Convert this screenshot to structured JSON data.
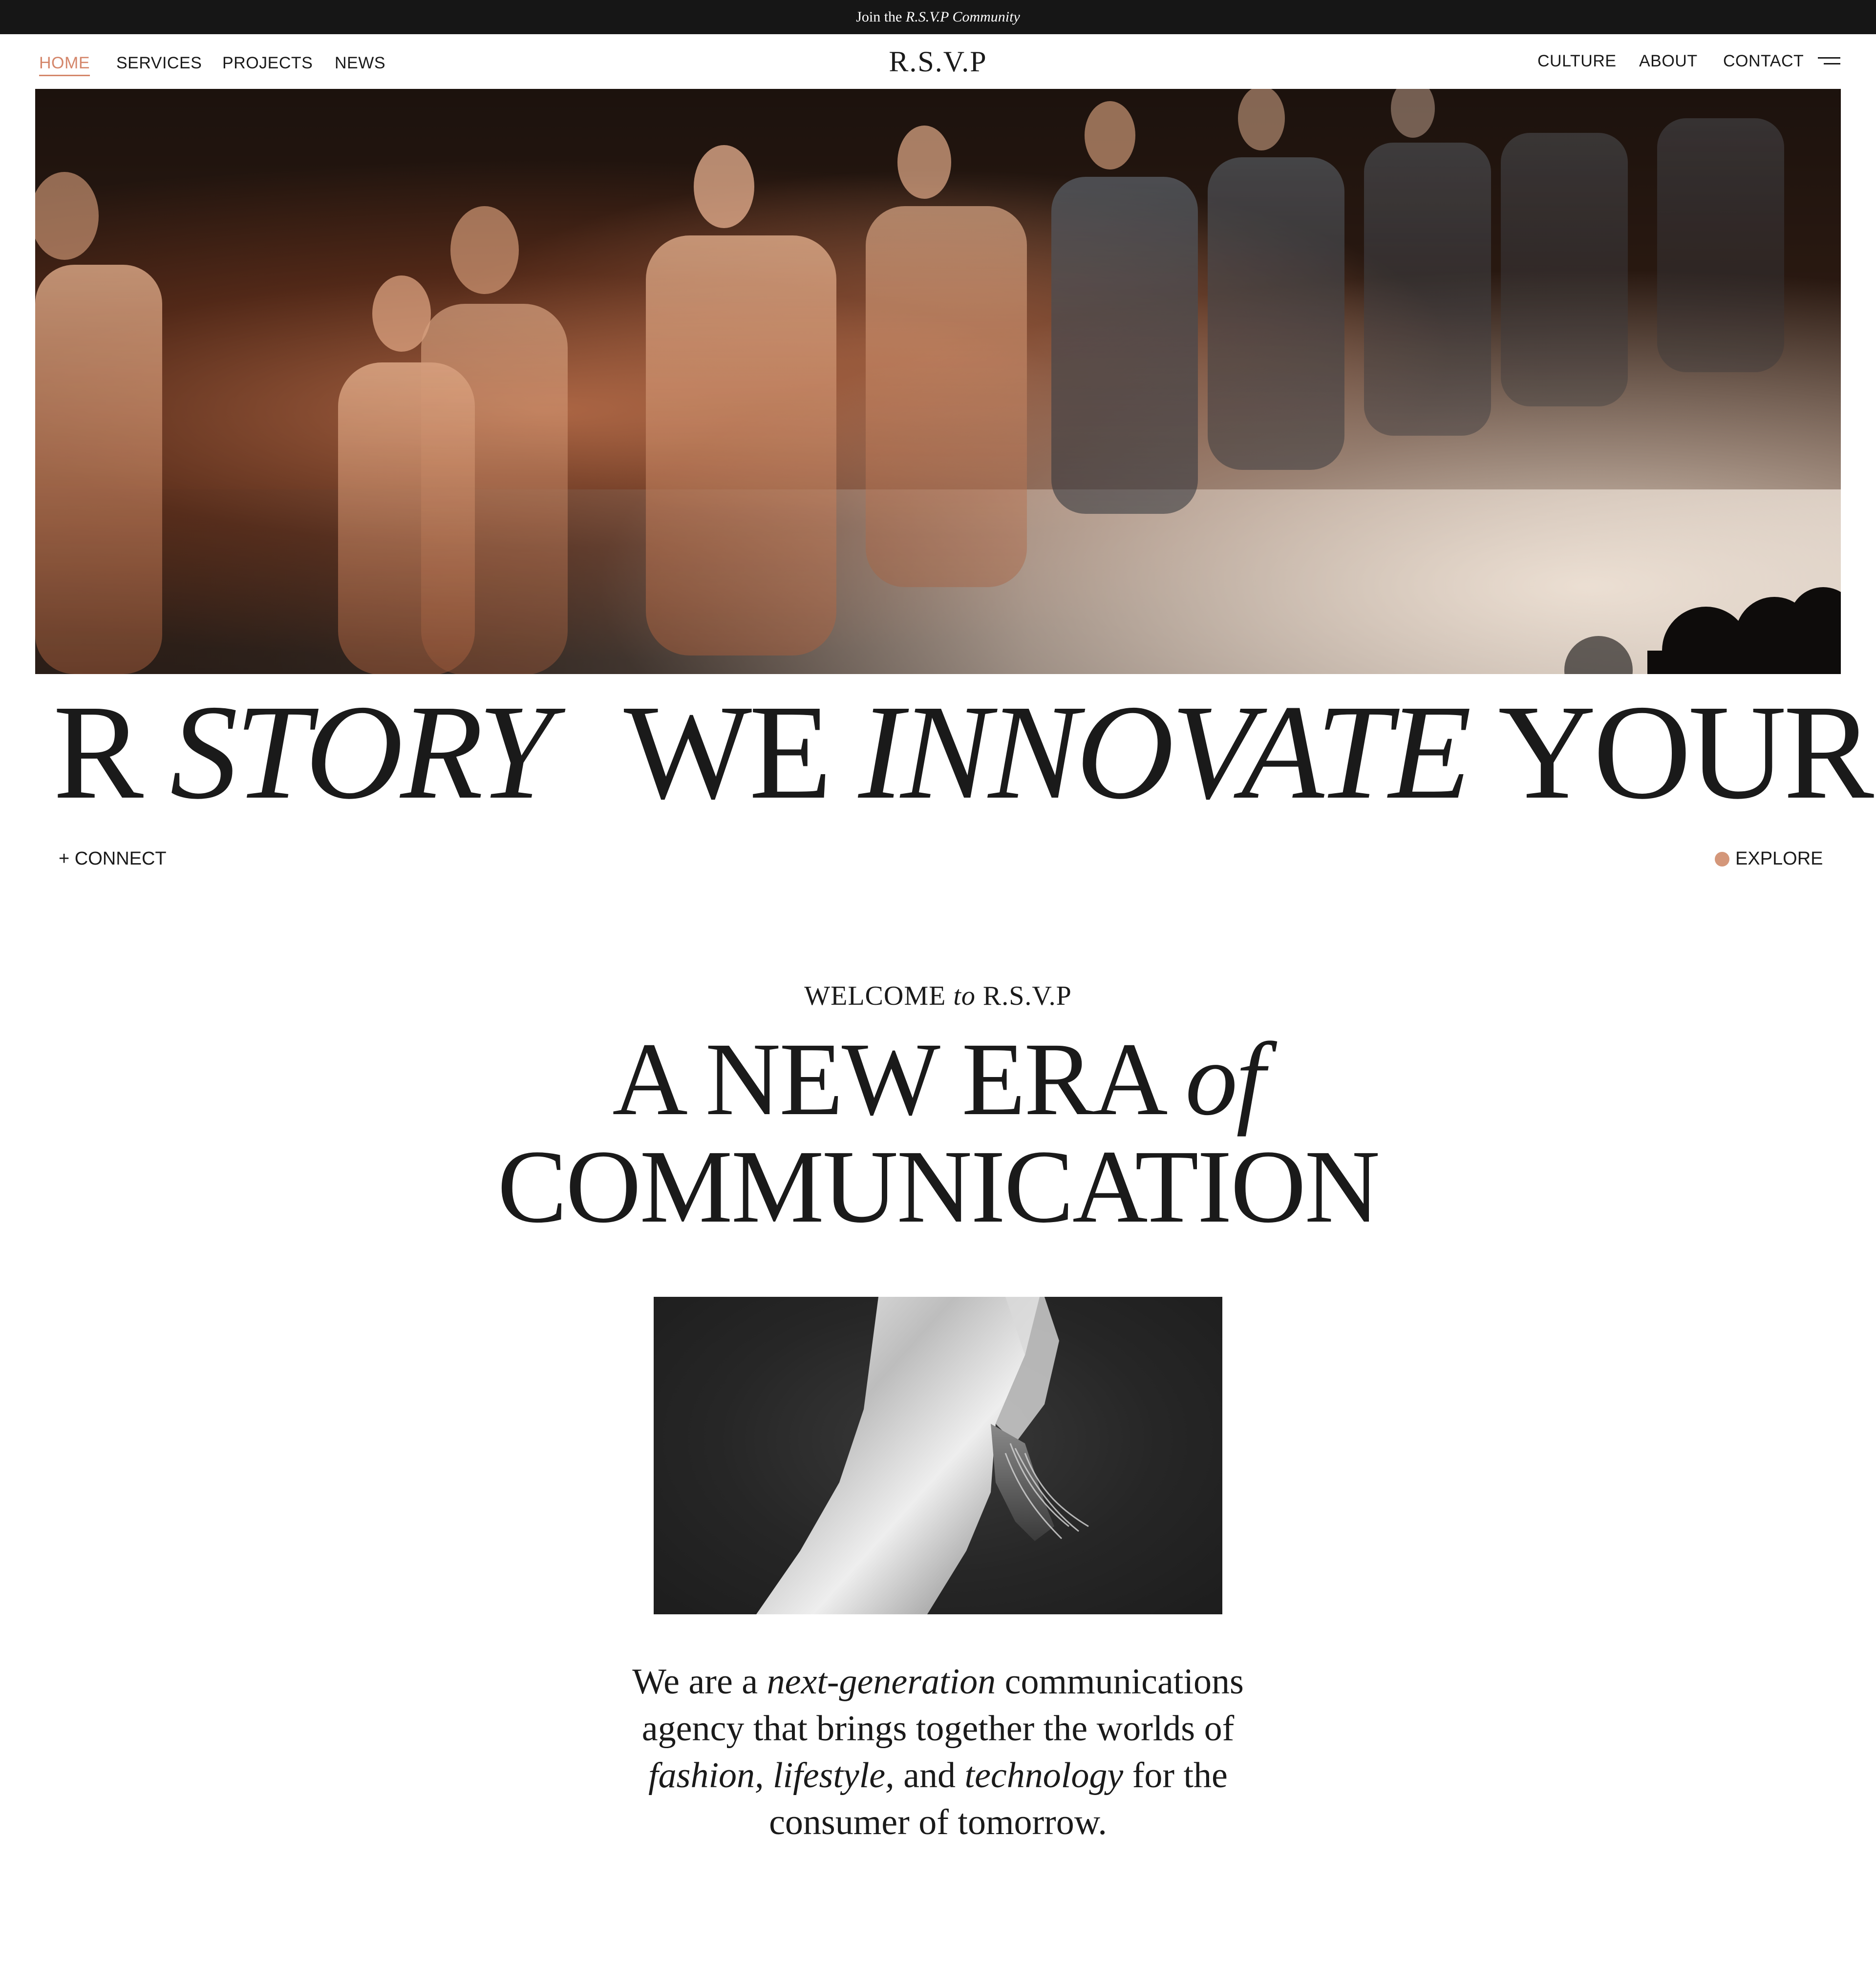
{
  "announcement": {
    "prefix": "Join the",
    "highlight": "R.S.V.P Community"
  },
  "nav": {
    "left": [
      "HOME",
      "SERVICES",
      "PROJECTS",
      "NEWS"
    ],
    "logo": "R.S.V.P",
    "right": [
      "CULTURE",
      "ABOUT",
      "CONTACT"
    ],
    "active": "HOME",
    "menu_icon": "hamburger-menu-icon"
  },
  "marquee": {
    "segments": [
      {
        "text": "R",
        "italic": false
      },
      {
        "text": "STORY",
        "italic": true
      },
      {
        "text": "WE",
        "italic": false
      },
      {
        "text": "INNOVATE",
        "italic": true
      },
      {
        "text": "YOUR",
        "italic": false
      }
    ]
  },
  "actions": {
    "connect": "+ CONNECT",
    "explore": "EXPLORE"
  },
  "welcome": {
    "pre": "WELCOME",
    "mid": "to",
    "post": "R.S.V.P"
  },
  "headline": {
    "line1_main": "A NEW ERA",
    "line1_italic": "of",
    "line2": "COMMUNICATION"
  },
  "about": {
    "p1": "We are a",
    "i1": "next-generation",
    "p2": "communications agency that brings together the worlds of",
    "i2": "fashion, lifestyle,",
    "p3": "and",
    "i3": "technology",
    "p4": "for the consumer of tomorrow."
  },
  "colors": {
    "accent": "#d4866a",
    "explore_dot": "#d4977a",
    "topbar": "#161616",
    "text": "#1a1a1a"
  }
}
